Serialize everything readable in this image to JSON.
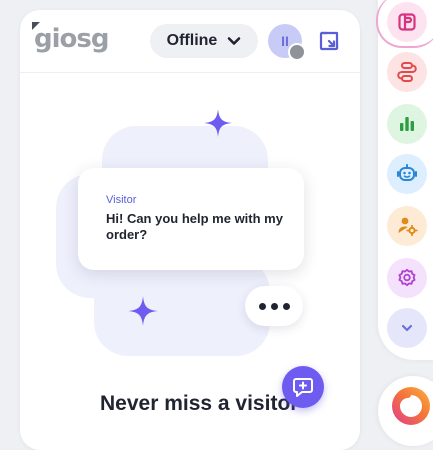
{
  "header": {
    "logo_text": "giosg",
    "status_label": "Offline",
    "avatar_initials": "II"
  },
  "chat_preview": {
    "sender_label": "Visitor",
    "message": "Hi! Can you help me with my order?",
    "typing_indicator": "..."
  },
  "tagline": "Never miss a visitor",
  "rail": {
    "items": [
      {
        "icon": "inbox-icon",
        "bg": "#fde3ef",
        "color": "#d8337f",
        "active": true
      },
      {
        "icon": "workflow-icon",
        "bg": "#fde3e3",
        "color": "#e14b4b"
      },
      {
        "icon": "reports-icon",
        "bg": "#def5e1",
        "color": "#2e9e42"
      },
      {
        "icon": "bot-icon",
        "bg": "#ddeefe",
        "color": "#2a87d8"
      },
      {
        "icon": "user-settings-icon",
        "bg": "#fdebd6",
        "color": "#e08a1a"
      },
      {
        "icon": "settings-icon",
        "bg": "#f4e1fb",
        "color": "#b042d1"
      },
      {
        "icon": "chevron-down-icon",
        "bg": "#e6e6fb",
        "color": "#6b6fd8"
      }
    ]
  },
  "colors": {
    "accent": "#6e5cf0",
    "sparkle": "#6e5cf0",
    "status_offline": "#8e9299"
  }
}
